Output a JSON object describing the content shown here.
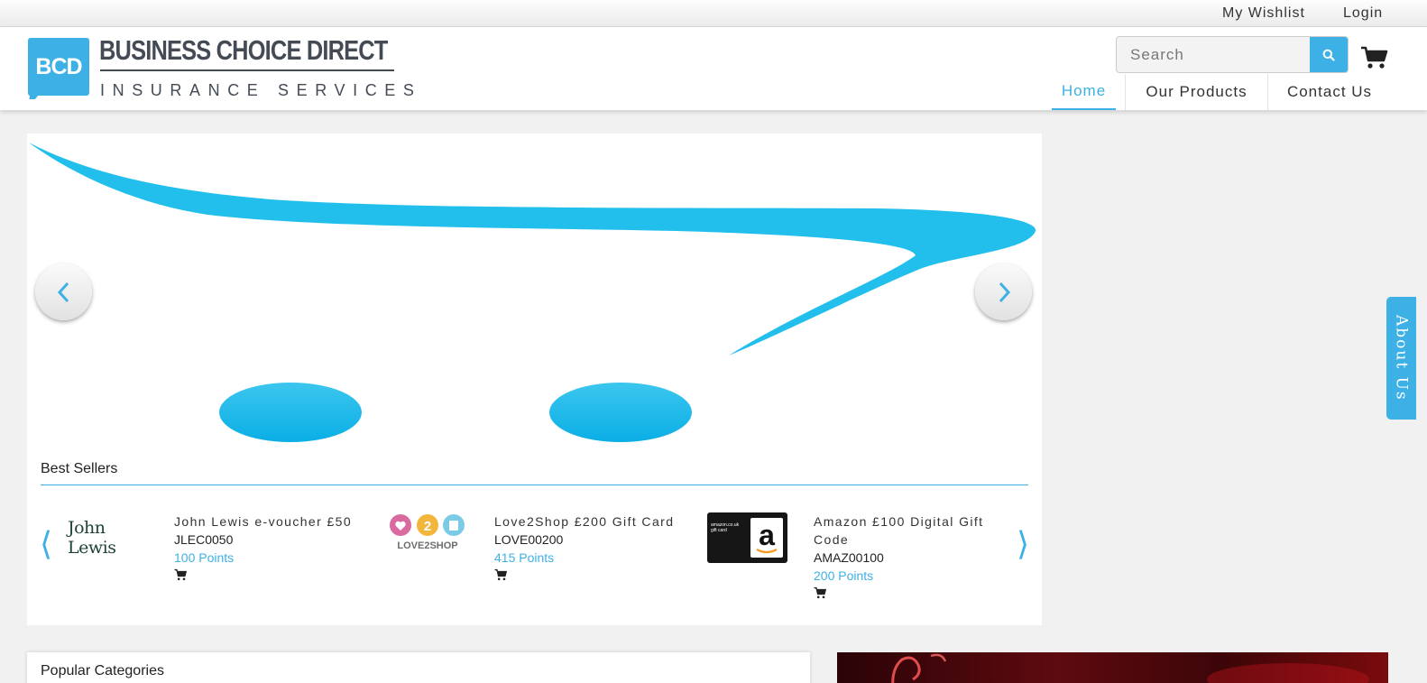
{
  "topbar": {
    "wishlist": "My Wishlist",
    "login": "Login"
  },
  "brand": {
    "badge": "BCD",
    "title": "BUSINESS CHOICE DIRECT",
    "subtitle": "INSURANCE SERVICES",
    "accent": "#3db1e6"
  },
  "search": {
    "placeholder": "Search",
    "icon": "search-icon"
  },
  "cart": {
    "icon": "shopping-cart-icon"
  },
  "nav": [
    {
      "label": "Home",
      "active": true
    },
    {
      "label": "Our Products",
      "active": false
    },
    {
      "label": "Contact Us",
      "active": false
    }
  ],
  "slider": {
    "prev_icon": "chevron-left-icon",
    "next_icon": "chevron-right-icon"
  },
  "best_sellers": {
    "title": "Best Sellers",
    "products": [
      {
        "logo_text": "John Lewis",
        "name": "John Lewis e-voucher £50",
        "code": "JLEC0050",
        "points": "100 Points"
      },
      {
        "logo_text": "LOVE2SHOP",
        "name": "Love2Shop £200 Gift Card",
        "code": "LOVE00200",
        "points": "415 Points"
      },
      {
        "logo_text": "amazon.co.uk gift card",
        "name": "Amazon £100 Digital Gift Code",
        "code": "AMAZ00100",
        "points": "200 Points"
      }
    ]
  },
  "about_tab": {
    "label": "About Us"
  },
  "popular": {
    "title": "Popular Categories"
  }
}
